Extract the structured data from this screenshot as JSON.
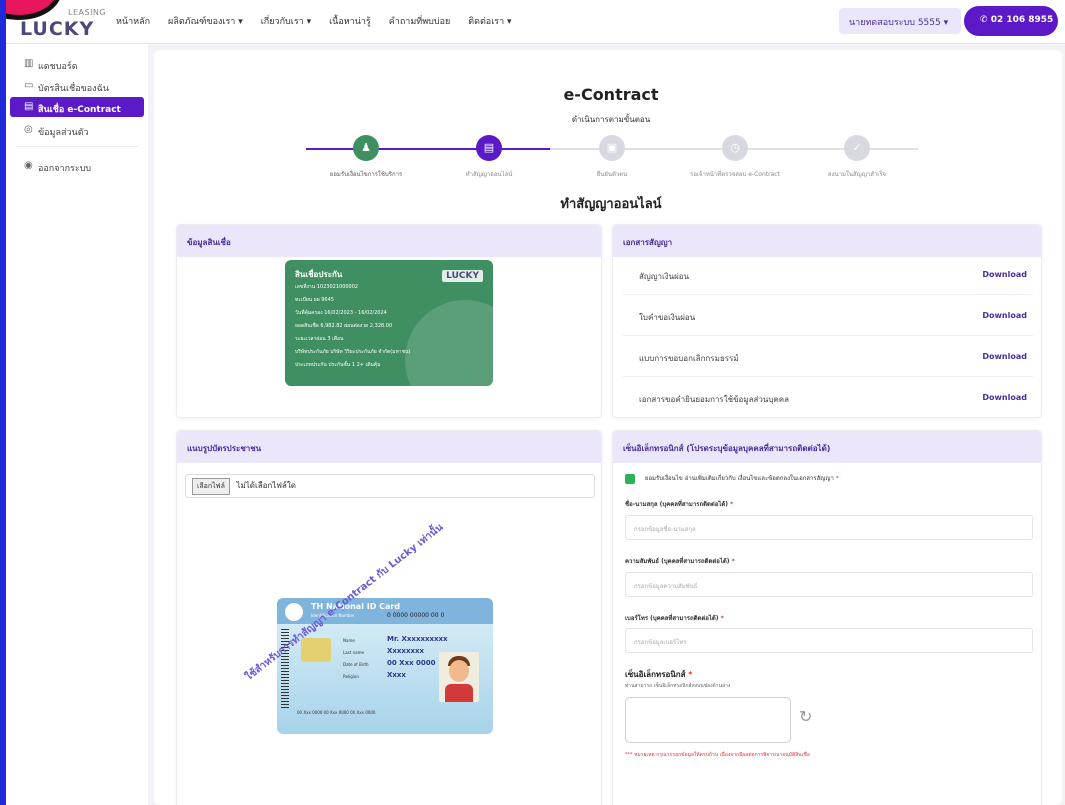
{
  "header": {
    "logo_small": "LEASING",
    "logo_big": "LUCKY",
    "nav": [
      "หน้าหลัก",
      "ผลิตภัณฑ์ของเรา ▾",
      "เกี่ยวกับเรา ▾",
      "เนื้อหาน่ารู้",
      "คำถามที่พบบ่อย",
      "ติดต่อเรา ▾"
    ],
    "user_label": "นายทดสอบระบบ 5555  ▾",
    "phone": "02 106 8955"
  },
  "sidebar": {
    "items": [
      {
        "label": "แดชบอร์ด",
        "icon": "dashboard-icon",
        "glyph": "▥"
      },
      {
        "label": "บัตรสินเชื่อของฉัน",
        "icon": "card-icon",
        "glyph": "▭"
      },
      {
        "label": "สินเชื่อ e-Contract",
        "icon": "contract-icon",
        "glyph": "▤"
      },
      {
        "label": "ข้อมูลส่วนตัว",
        "icon": "user-icon",
        "glyph": "◎"
      },
      {
        "label": "ออกจากระบบ",
        "icon": "logout-icon",
        "glyph": "◉"
      }
    ]
  },
  "page": {
    "title": "e-Contract",
    "subtitle": "ดำเนินการตามขั้นตอน",
    "section_title": "ทำสัญญาออนไลน์"
  },
  "stepper": {
    "steps": [
      {
        "label": "ยอมรับเงื่อนไขการใช้บริการ",
        "glyph": "♟",
        "color": "#3f8f63"
      },
      {
        "label": "ทำสัญญาออนไลน์",
        "glyph": "▤",
        "color": "#5b19c8"
      },
      {
        "label": "ยืนยันตัวตน",
        "glyph": "▣",
        "color": "#d8d8e0"
      },
      {
        "label": "รอเจ้าหน้าที่ตรวจสอบ e-Contract",
        "glyph": "◷",
        "color": "#d8d8e0"
      },
      {
        "label": "ลงนามในสัญญาสำเร็จ",
        "glyph": "✓",
        "color": "#d8d8e0"
      }
    ]
  },
  "loan_info": {
    "header": "ข้อมูลสินเชื่อ",
    "card_title": "สินเชื่อประกัน",
    "card_brand": "LUCKY",
    "rows": [
      "เลขที่งาน 1023021000002",
      "ทะเบียน   ผผ 9645",
      "วันที่คุ้มครอง  16/02/2023 - 16/02/2024",
      "ยอดสินเชื่อ  6,982.82   ผ่อนต่องวด  2,328.00",
      "ระยะเวลาผ่อน  3 เดือน",
      "บริษัทประกันภัย  บริษัท วิริยะประกันภัย จำกัด(มหาชน)",
      "ประเภทประกัน  ประกันชั้น 1 2+ เดิมคุ้ม"
    ]
  },
  "documents": {
    "header": "เอกสารสัญญา",
    "download_label": "Download",
    "items": [
      "สัญญาเงินผ่อน",
      "ใบคำขอเงินผ่อน",
      "แบบการขอบอกเลิกกรมธรรม์",
      "เอกสารขอคำยินยอมการใช้ข้อมูลส่วนบุคคล"
    ]
  },
  "id_upload": {
    "header": "แนบรูปบัตรประชาชน",
    "choose_label": "เลือกไฟล์",
    "no_file": "ไม่ได้เลือกไฟล์ใด",
    "card": {
      "title": "TH National ID Card",
      "subtitle": "Identification Number",
      "number": "0 0000 00000 00 0",
      "fields": [
        {
          "label": "Name",
          "value": "Mr. Xxxxxxxxxx"
        },
        {
          "label": "Last name",
          "value": "Xxxxxxxx"
        },
        {
          "label": "Date of Birth",
          "value": "00 Xxx 0000"
        },
        {
          "label": "Religion",
          "value": "Xxxx"
        }
      ],
      "footer": "00 Xxx 0000     00 Xxx 0000     00 Xxx 0000"
    },
    "watermark": "ใช้สำหรับการทำสัญญา e-Contract กับ Lucky เท่านั้น"
  },
  "signature_form": {
    "header": "เซ็นอิเล็กทรอนิกส์ (โปรดระบุข้อมูลบุคคลที่สามารถติดต่อได้)",
    "consent": "ยอมรับเงื่อนไข อ่านเพิ่มเติมเกี่ยวกับ เงื่อนไขและข้อตกลงในเอกสารสัญญา",
    "fields": [
      {
        "label": "ชื่อ-นามสกุล (บุคคลที่สามารถติดต่อได้)",
        "placeholder": "กรอกข้อมูลชื่อ-นามสกุล"
      },
      {
        "label": "ความสัมพันธ์ (บุคคลที่สามารถติดต่อได้)",
        "placeholder": "กรอกข้อมูลความสัมพันธ์"
      },
      {
        "label": "เบอร์โทร (บุคคลที่สามารถติดต่อได้)",
        "placeholder": "กรอกข้อมูลเบอร์โทร"
      }
    ],
    "signature_title": "เซ็นอิเล็กทรอนิกส์",
    "signature_sub": "ท่านสามารถ เซ็นอิเล็กทรอนิกส์ลงบนช่องด้านล่าง",
    "reset_glyph": "↻",
    "note": "*** หมายเหตุ กรุณากรอกข้อมูลให้ครบถ้วน เนื่องจากมีผลต่อการพิจารณาอนุมัติสินเชื่อ"
  }
}
